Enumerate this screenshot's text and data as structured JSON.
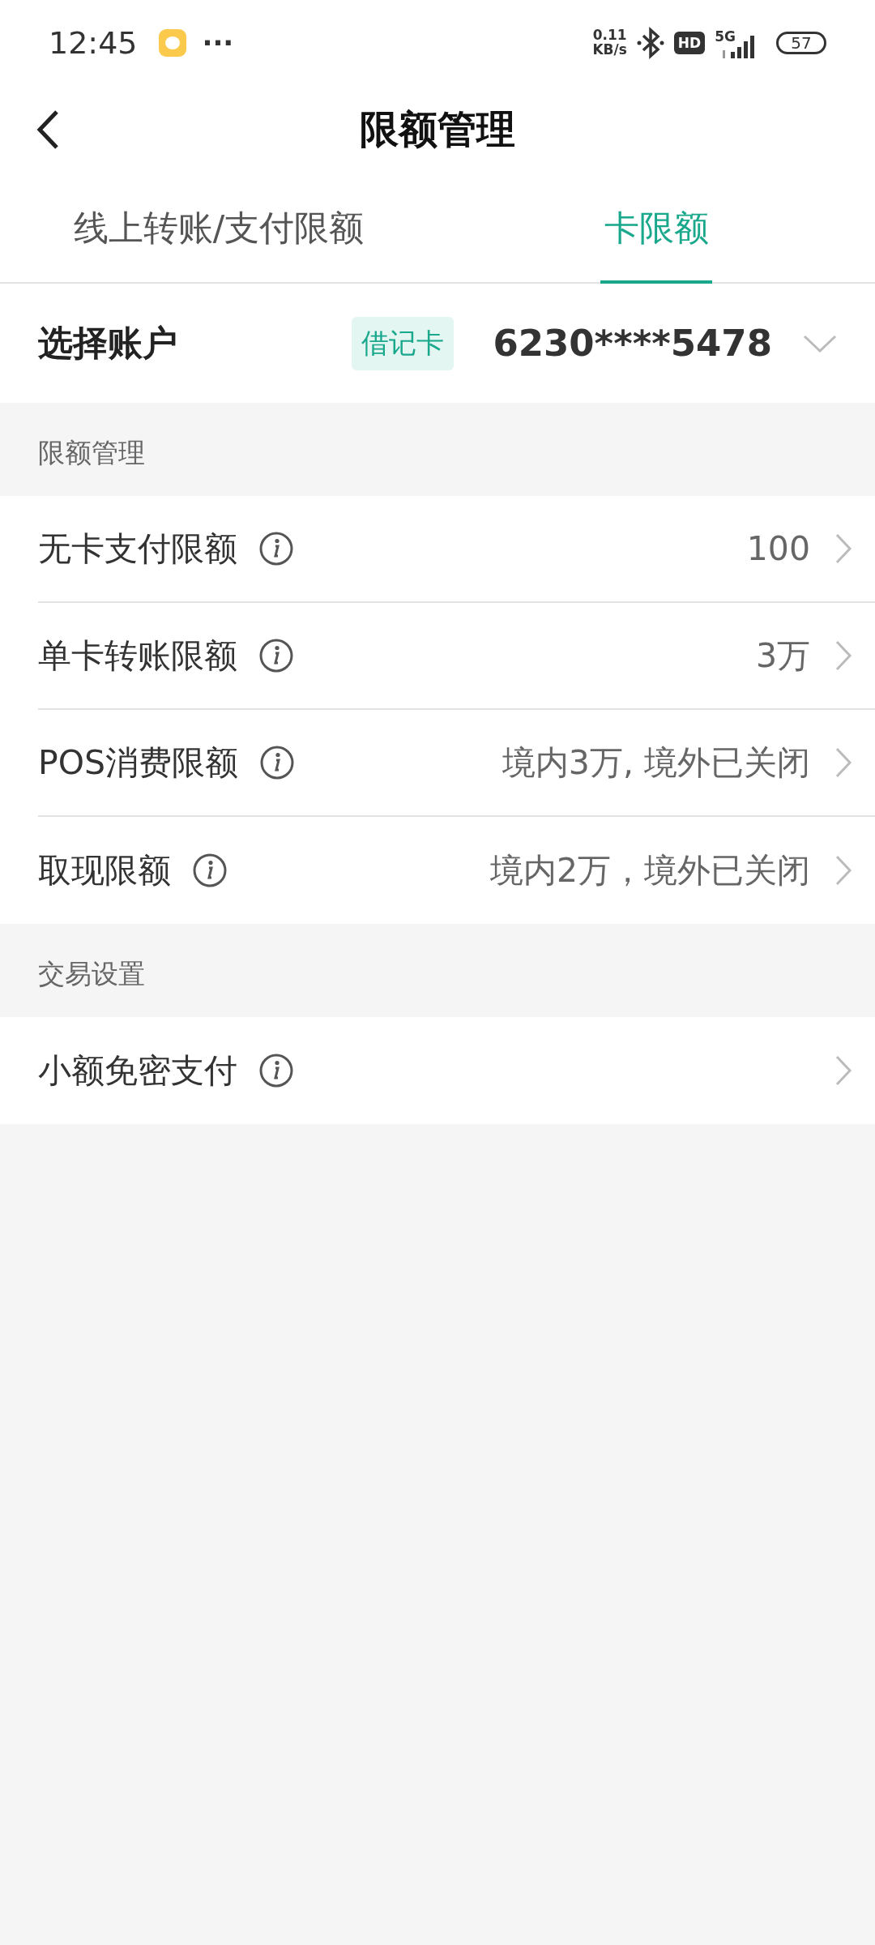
{
  "status_bar": {
    "time": "12:45",
    "more": "···",
    "net_speed_value": "0.11",
    "net_speed_unit": "KB/s",
    "hd": "HD",
    "network": "5G",
    "battery": "57"
  },
  "header": {
    "title": "限额管理"
  },
  "tabs": [
    {
      "label": "线上转账/支付限额",
      "selected": false
    },
    {
      "label": "卡限额",
      "selected": true
    }
  ],
  "account": {
    "label": "选择账户",
    "card_type": "借记卡",
    "card_number": "6230****5478"
  },
  "sections": [
    {
      "title": "限额管理",
      "rows": [
        {
          "label": "无卡支付限额",
          "value": "100"
        },
        {
          "label": "单卡转账限额",
          "value": "3万"
        },
        {
          "label": "POS消费限额",
          "value": "境内3万, 境外已关闭"
        },
        {
          "label": "取现限额",
          "value": "境内2万，境外已关闭"
        }
      ]
    },
    {
      "title": "交易设置",
      "rows": [
        {
          "label": "小额免密支付"
        }
      ]
    }
  ]
}
